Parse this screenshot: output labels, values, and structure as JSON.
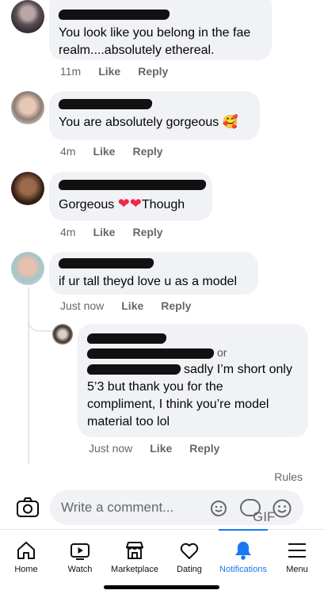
{
  "comments": [
    {
      "text_line1": "You look like you belong in the fae",
      "text_line2": "realm....absolutely ethereal.",
      "time": "11m",
      "like": "Like",
      "reply": "Reply"
    },
    {
      "text": "You are absolutely gorgeous 🥰",
      "time": "4m",
      "like": "Like",
      "reply": "Reply"
    },
    {
      "text_before": "Gorgeous ",
      "hearts": "❤❤",
      "text_after": "Though",
      "time": "4m",
      "like": "Like",
      "reply": "Reply"
    },
    {
      "text": "if ur tall theyd love u as a model",
      "time": "Just now",
      "like": "Like",
      "reply": "Reply"
    }
  ],
  "reply_comment": {
    "tail_a": "or",
    "text_line1": "sadly I’m short only",
    "text_line2": "5’3 but thank you for the",
    "text_line3": "compliment, I think you’re model",
    "text_line4": "material too lol",
    "time": "Just now",
    "like": "Like",
    "reply": "Reply"
  },
  "rules_link": "Rules",
  "composer": {
    "placeholder": "Write a comment...",
    "gif_label": "GIF"
  },
  "tabs": [
    {
      "label": "Home",
      "icon": "home-icon"
    },
    {
      "label": "Watch",
      "icon": "watch-icon"
    },
    {
      "label": "Marketplace",
      "icon": "marketplace-icon"
    },
    {
      "label": "Dating",
      "icon": "dating-icon"
    },
    {
      "label": "Notifications",
      "icon": "bell-icon",
      "active": true
    },
    {
      "label": "Menu",
      "icon": "menu-icon"
    }
  ],
  "colors": {
    "accent": "#1877f2",
    "bubble": "#f0f2f5",
    "meta": "#65676b",
    "heart": "#f02849"
  }
}
